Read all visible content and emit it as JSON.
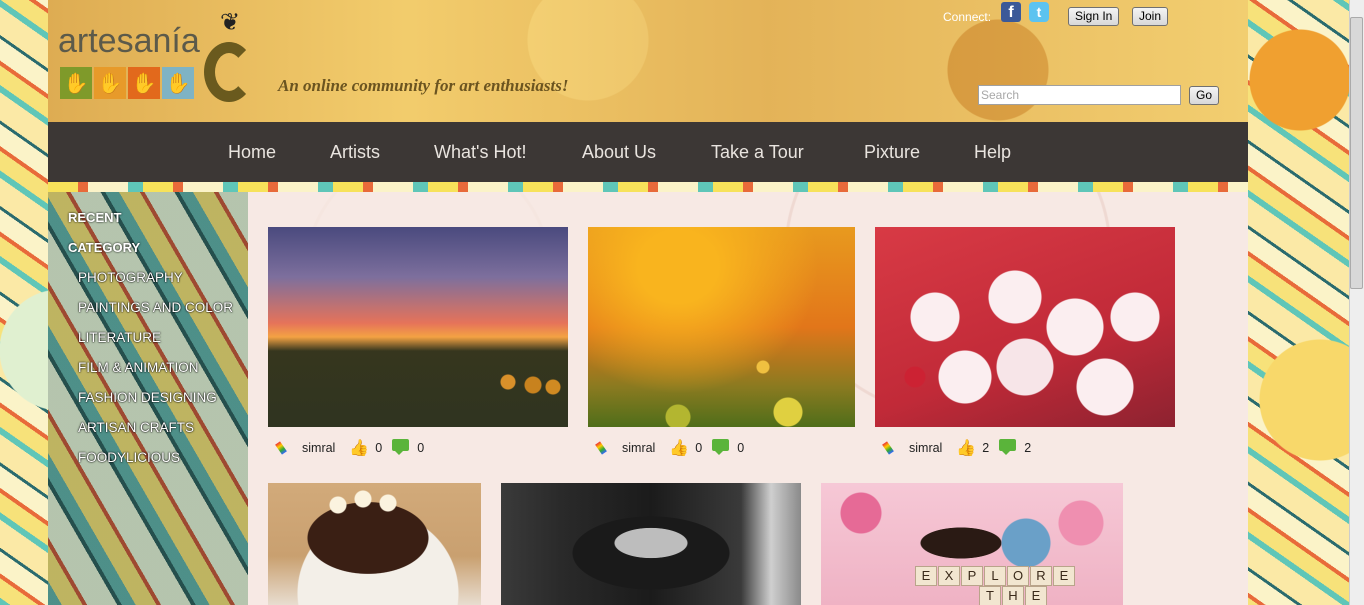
{
  "brand": {
    "logo_text": "artesanía",
    "tagline": "An online community for art enthusiasts!",
    "hand_colors": [
      "#7f9a2a",
      "#e79a2a",
      "#e2691c",
      "#7fb3c4"
    ]
  },
  "header": {
    "connect_label": "Connect:",
    "facebook_glyph": "f",
    "twitter_glyph": "t",
    "signin_label": "Sign In",
    "join_label": "Join",
    "search_placeholder": "Search",
    "go_label": "Go"
  },
  "nav": {
    "items": [
      "Home",
      "Artists",
      "What's Hot!",
      "About Us",
      "Take a Tour",
      "Pixture",
      "Help"
    ]
  },
  "sidebar": {
    "recent": "RECENT",
    "category": "CATEGORY",
    "items": [
      "PHOTOGRAPHY",
      "PAINTINGS AND COLOR",
      "LITERATURE",
      "FILM & ANIMATION",
      "FASHION DESIGNING",
      "ARTISAN CRAFTS",
      "FOODYLICIOUS"
    ]
  },
  "cards": [
    {
      "user": "simral",
      "likes": "0",
      "comments": "0",
      "image": "sunset-field"
    },
    {
      "user": "simral",
      "likes": "0",
      "comments": "0",
      "image": "orange-bokeh"
    },
    {
      "user": "simral",
      "likes": "2",
      "comments": "2",
      "image": "cupcakes"
    },
    {
      "image": "chocolate-cake"
    },
    {
      "image": "woman-portrait"
    },
    {
      "image": "scrabble-explore"
    }
  ],
  "scrabble_tiles": [
    "E",
    "X",
    "P",
    "L",
    "O",
    "R",
    "E",
    "T",
    "H",
    "E"
  ],
  "icons": [
    "brush-icon",
    "thumbs-up-icon",
    "comment-icon",
    "facebook-icon",
    "twitter-icon",
    "butterfly-icon"
  ]
}
